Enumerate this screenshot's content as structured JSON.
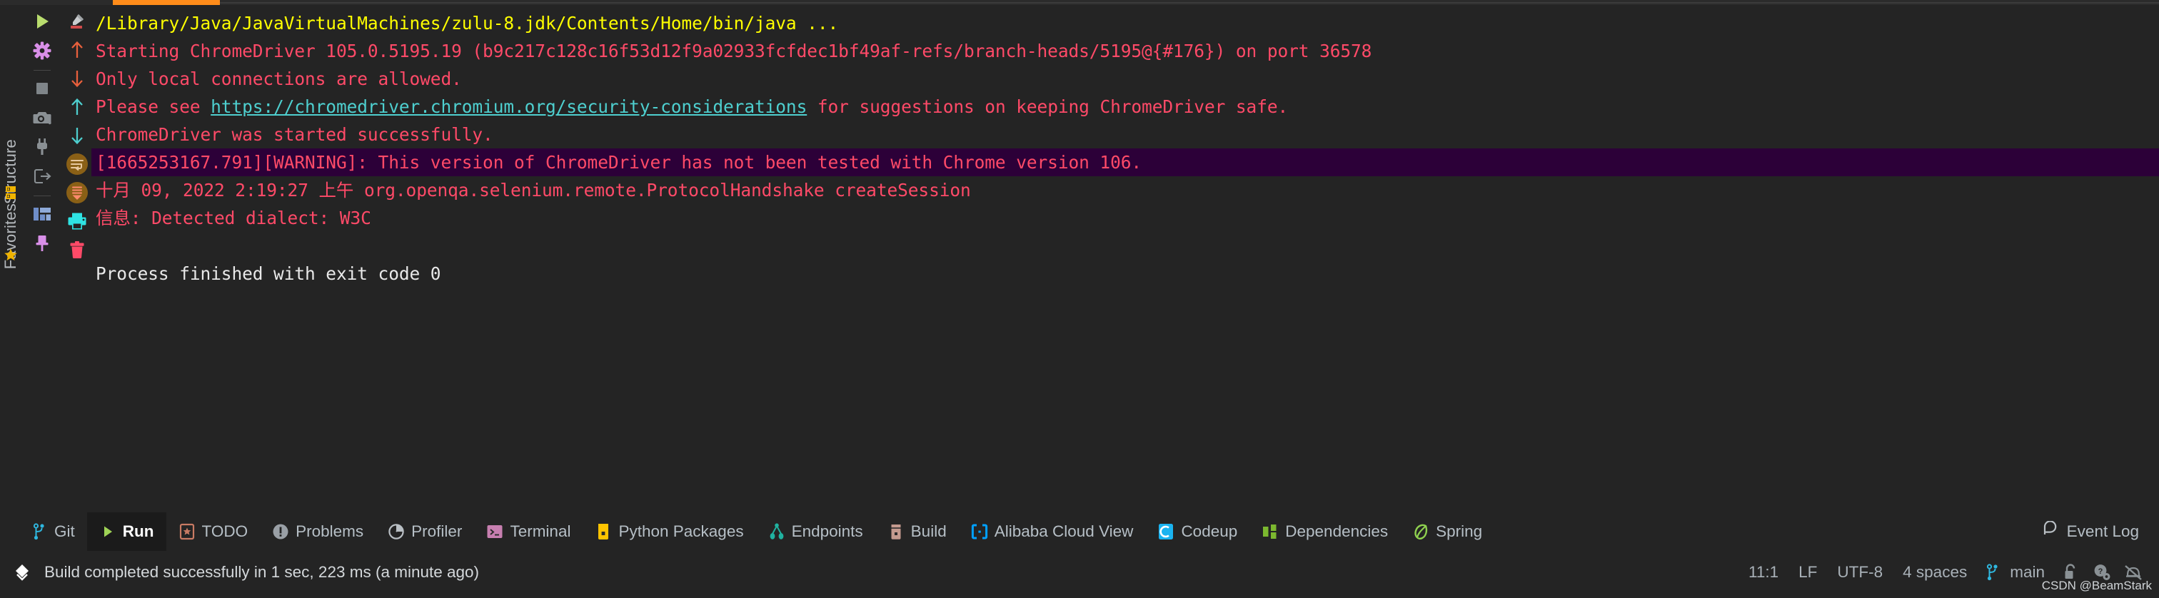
{
  "window": {
    "theme_bg": "#242424",
    "accent": "#ff8c1a"
  },
  "left_rail": {
    "structure_label": "Structure",
    "favorites_label": "Favorites",
    "icons": [
      "structure-mark-icon",
      "favorites-star-icon"
    ]
  },
  "run_toolbar": {
    "buttons": [
      {
        "name": "rerun-button",
        "icon": "play-icon",
        "color": "#b9dd6e"
      },
      {
        "name": "run-configurations",
        "icon": "gear-icon",
        "color": "#d98fe8"
      },
      {
        "name": "stop-button",
        "icon": "stop-square-icon",
        "color": "#7f8589"
      },
      {
        "name": "screenshot-button",
        "icon": "camera-icon",
        "color": "#8a9094"
      },
      {
        "name": "attach-profiler-button",
        "icon": "plug-icon",
        "color": "#8a9094"
      },
      {
        "name": "export-button",
        "icon": "export-icon",
        "color": "#8a9094"
      },
      {
        "name": "layout-button",
        "icon": "layout-icon",
        "color": "#6f8ec9"
      },
      {
        "name": "pin-tab-button",
        "icon": "pin-icon",
        "color": "#d98fe8"
      }
    ]
  },
  "console_gutter": {
    "buttons": [
      {
        "name": "edit-source-button",
        "icon": "pencil-eraser-icon",
        "color": "#d05050"
      },
      {
        "name": "prev-occurrence-up",
        "icon": "arrow-up-icon",
        "color": "#e8603c"
      },
      {
        "name": "next-occurrence-down",
        "icon": "arrow-down-icon",
        "color": "#e8603c"
      },
      {
        "name": "prev-message-up",
        "icon": "arrow-up-icon",
        "color": "#4ecfcf"
      },
      {
        "name": "next-message-down",
        "icon": "arrow-down-icon",
        "color": "#4ecfcf"
      },
      {
        "name": "soft-wrap-button",
        "icon": "soft-wrap-icon",
        "color": "#8a6016"
      },
      {
        "name": "scroll-to-end-button",
        "icon": "scroll-to-end-icon",
        "color": "#8a6016"
      },
      {
        "name": "print-button",
        "icon": "printer-icon",
        "color": "#2fe3e3"
      },
      {
        "name": "clear-all-button",
        "icon": "trash-icon",
        "color": "#ff4a68"
      }
    ]
  },
  "console": {
    "lines": [
      {
        "name": "console-line-command",
        "style": "yellow",
        "text": "/Library/Java/JavaVirtualMachines/zulu-8.jdk/Contents/Home/bin/java ..."
      },
      {
        "name": "console-line-chromedriver-start",
        "style": "red",
        "text": "Starting ChromeDriver 105.0.5195.19 (b9c217c128c16f53d12f9a02933fcfdec1bf49af-refs/branch-heads/5195@{#176}) on port 36578"
      },
      {
        "name": "console-line-local-connections",
        "style": "red",
        "text": "Only local connections are allowed."
      },
      {
        "name": "console-line-security-note",
        "style": "red-with-link",
        "text_before": "Please see ",
        "link_text": "https://chromedriver.chromium.org/security-considerations",
        "text_after": " for suggestions on keeping ChromeDriver safe."
      },
      {
        "name": "console-line-started-successfully",
        "style": "red",
        "text": "ChromeDriver was started successfully."
      },
      {
        "name": "console-line-warning",
        "style": "red-highlight",
        "text": "[1665253167.791][WARNING]: This version of ChromeDriver has not been tested with Chrome version 106."
      },
      {
        "name": "console-line-protocol-handshake",
        "style": "red",
        "text": "十月 09, 2022 2:19:27 上午 org.openqa.selenium.remote.ProtocolHandshake createSession"
      },
      {
        "name": "console-line-dialect",
        "style": "red",
        "text": "信息: Detected dialect: W3C"
      },
      {
        "name": "console-line-blank",
        "style": "blank",
        "text": ""
      },
      {
        "name": "console-line-exit-code",
        "style": "white",
        "text": "Process finished with exit code 0"
      }
    ]
  },
  "tool_tabs": {
    "items": [
      {
        "name": "tab-git",
        "label": "Git",
        "icon": "git-branch-icon",
        "color": "#2fb8e0",
        "active": false
      },
      {
        "name": "tab-run",
        "label": "Run",
        "icon": "play-icon",
        "color": "#9fd356",
        "active": true
      },
      {
        "name": "tab-todo",
        "label": "TODO",
        "icon": "todo-icon",
        "color": "#c87a63",
        "active": false
      },
      {
        "name": "tab-problems",
        "label": "Problems",
        "icon": "warning-circle-icon",
        "color": "#9aa0a6",
        "active": false
      },
      {
        "name": "tab-profiler",
        "label": "Profiler",
        "icon": "profiler-icon",
        "color": "#b9bfc4",
        "active": false
      },
      {
        "name": "tab-terminal",
        "label": "Terminal",
        "icon": "terminal-icon",
        "color": "#c77fb0",
        "active": false
      },
      {
        "name": "tab-python-packages",
        "label": "Python Packages",
        "icon": "package-icon",
        "color": "#ffc400",
        "active": false
      },
      {
        "name": "tab-endpoints",
        "label": "Endpoints",
        "icon": "endpoints-icon",
        "color": "#20b2a0",
        "active": false
      },
      {
        "name": "tab-build",
        "label": "Build",
        "icon": "build-icon",
        "color": "#c49a8e",
        "active": false
      },
      {
        "name": "tab-alibaba-cloud-view",
        "label": "Alibaba Cloud View",
        "icon": "alibaba-cloud-icon",
        "color": "#00a0ff",
        "active": false
      },
      {
        "name": "tab-codeup",
        "label": "Codeup",
        "icon": "codeup-icon",
        "color": "#1ab3f0",
        "active": false
      },
      {
        "name": "tab-dependencies",
        "label": "Dependencies",
        "icon": "dependencies-icon",
        "color": "#7cb82f",
        "active": false
      },
      {
        "name": "tab-spring",
        "label": "Spring",
        "icon": "spring-leaf-icon",
        "color": "#8fd14f",
        "active": false
      }
    ],
    "event_log": {
      "label": "Event Log",
      "icon": "event-log-icon"
    }
  },
  "status_bar": {
    "build_icon": "build-diamond-icon",
    "message": "Build completed successfully in 1 sec, 223 ms (a minute ago)",
    "caret_position": "11:1",
    "line_separator": "LF",
    "encoding": "UTF-8",
    "indent": "4 spaces",
    "branch": "main",
    "branch_icon": "git-branch-icon",
    "icons": [
      {
        "name": "read-only-lock-icon",
        "color": "#8a9195"
      },
      {
        "name": "inspections-icon",
        "color": "#8a9195"
      },
      {
        "name": "notifications-mute-icon",
        "color": "#8a9195"
      }
    ],
    "watermark": "CSDN @BeamStark"
  }
}
